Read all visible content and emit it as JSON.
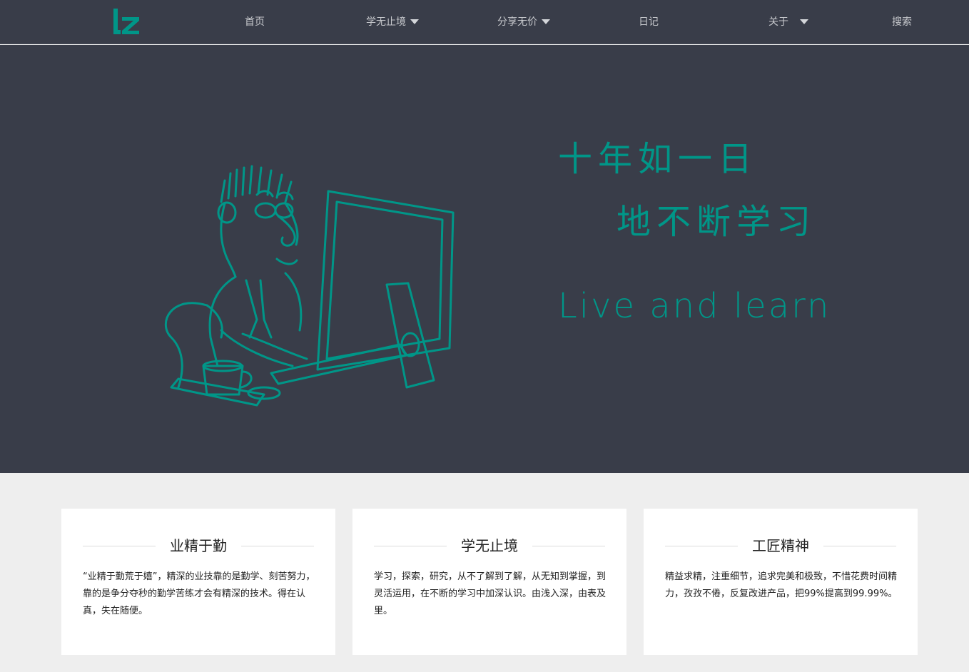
{
  "brand": {
    "logo_text": "lz",
    "accent_color": "#009688",
    "bg_dark": "#393d49"
  },
  "nav": {
    "home": "首页",
    "learning": "学无止境",
    "sharing": "分享无价",
    "diary": "日记",
    "about": "关于",
    "search": "搜索"
  },
  "hero": {
    "line1": "十年如一日",
    "line2": "地不断学习",
    "line3": "Live and learn",
    "illustration": "developer-at-computer-illustration"
  },
  "cards": [
    {
      "title": "业精于勤",
      "text": "“业精于勤荒于嬉”，精深的业技靠的是勤学、刻苦努力，靠的是争分夺秒的勤学苦练才会有精深的技术。得在认真，失在随便。"
    },
    {
      "title": "学无止境",
      "text": "学习，探索，研究，从不了解到了解，从无知到掌握，到灵活运用，在不断的学习中加深认识。由浅入深，由表及里。"
    },
    {
      "title": "工匠精神",
      "text": "精益求精，注重细节，追求完美和极致，不惜花费时间精力，孜孜不倦，反复改进产品，把99%提高到99.99%。"
    }
  ]
}
